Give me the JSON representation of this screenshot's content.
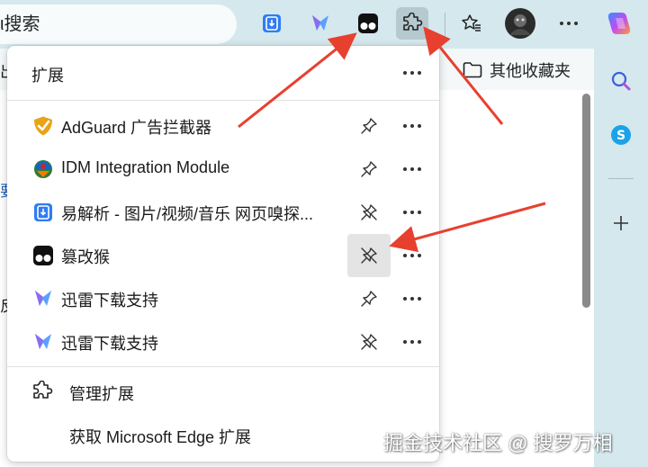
{
  "toolbar": {
    "search_placeholder": "ι搜索",
    "icons": [
      "download-icon",
      "xunlei-icon",
      "tampermonkey-icon",
      "extensions-icon",
      "favorites-icon",
      "avatar",
      "more-icon",
      "copilot-icon"
    ]
  },
  "favorites_bar": {
    "left_fragment": "出",
    "folder_label": "其他收藏夹"
  },
  "page": {
    "fragment_1": "要",
    "fragment_2": "反"
  },
  "popup": {
    "title": "扩展",
    "extensions": [
      {
        "name": "AdGuard 广告拦截器",
        "pinned": true
      },
      {
        "name": "IDM Integration Module",
        "pinned": true
      },
      {
        "name": "易解析 - 图片/视频/音乐 网页嗅探...",
        "pinned": false
      },
      {
        "name": "篡改猴",
        "pinned": false,
        "highlighted": true
      },
      {
        "name": "迅雷下载支持",
        "pinned": true
      },
      {
        "name": "迅雷下载支持",
        "pinned": false
      }
    ],
    "manage_label": "管理扩展",
    "get_label": "获取 Microsoft Edge 扩展"
  },
  "watermark": "掘金技术社区 @ 搜罗万相",
  "colors": {
    "annotation_arrow": "#e8402f",
    "toolbar_bg": "#d5e8ee",
    "pin_highlight": "#e4e4e4"
  }
}
